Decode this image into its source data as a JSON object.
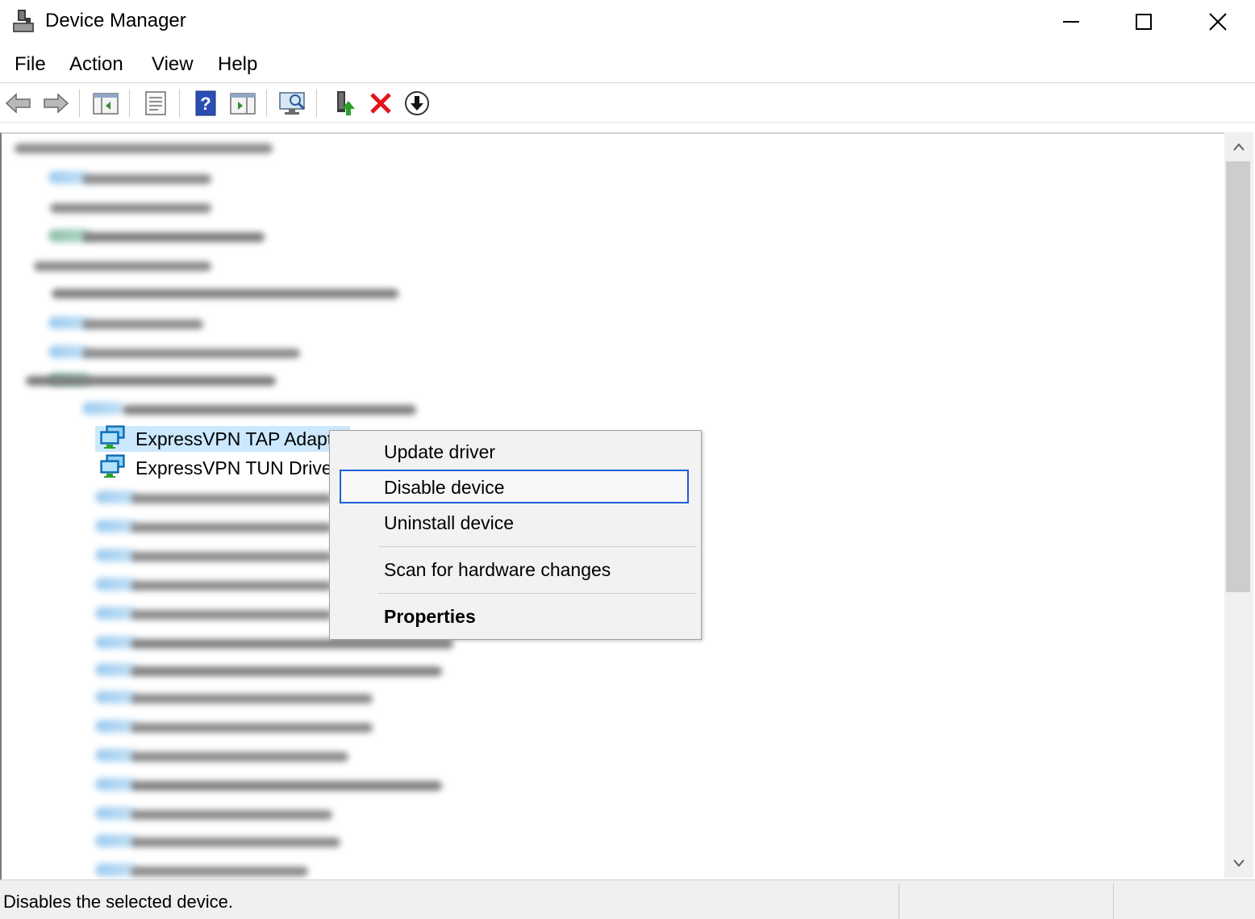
{
  "window": {
    "title": "Device Manager",
    "controls": [
      "minimize",
      "maximize",
      "close"
    ]
  },
  "menubar": {
    "items": [
      {
        "label": "File"
      },
      {
        "label": "Action"
      },
      {
        "label": "View"
      },
      {
        "label": "Help"
      }
    ]
  },
  "toolbar": {
    "buttons": [
      "back-arrow-icon",
      "forward-arrow-icon",
      "show-hide-console-tree-icon",
      "properties-icon",
      "help-icon",
      "show-hide-action-pane-icon",
      "scan-hardware-icon",
      "update-driver-icon",
      "uninstall-device-icon",
      "disable-device-icon"
    ]
  },
  "tree": {
    "devices": [
      {
        "label": "ExpressVPN TAP Adapt",
        "selected": true,
        "icon": "network-adapter-icon"
      },
      {
        "label": "ExpressVPN TUN Driver",
        "selected": false,
        "icon": "network-adapter-icon"
      }
    ]
  },
  "context_menu": {
    "items": {
      "update": "Update driver",
      "disable": "Disable device",
      "uninstall": "Uninstall device",
      "scan": "Scan for hardware changes",
      "properties": "Properties"
    },
    "focused": "disable"
  },
  "status_bar": {
    "text": "Disables the selected device."
  },
  "colors": {
    "selection": "#cce8ff",
    "focus_border": "#1c5fd6",
    "delete_red": "#e3141a"
  }
}
